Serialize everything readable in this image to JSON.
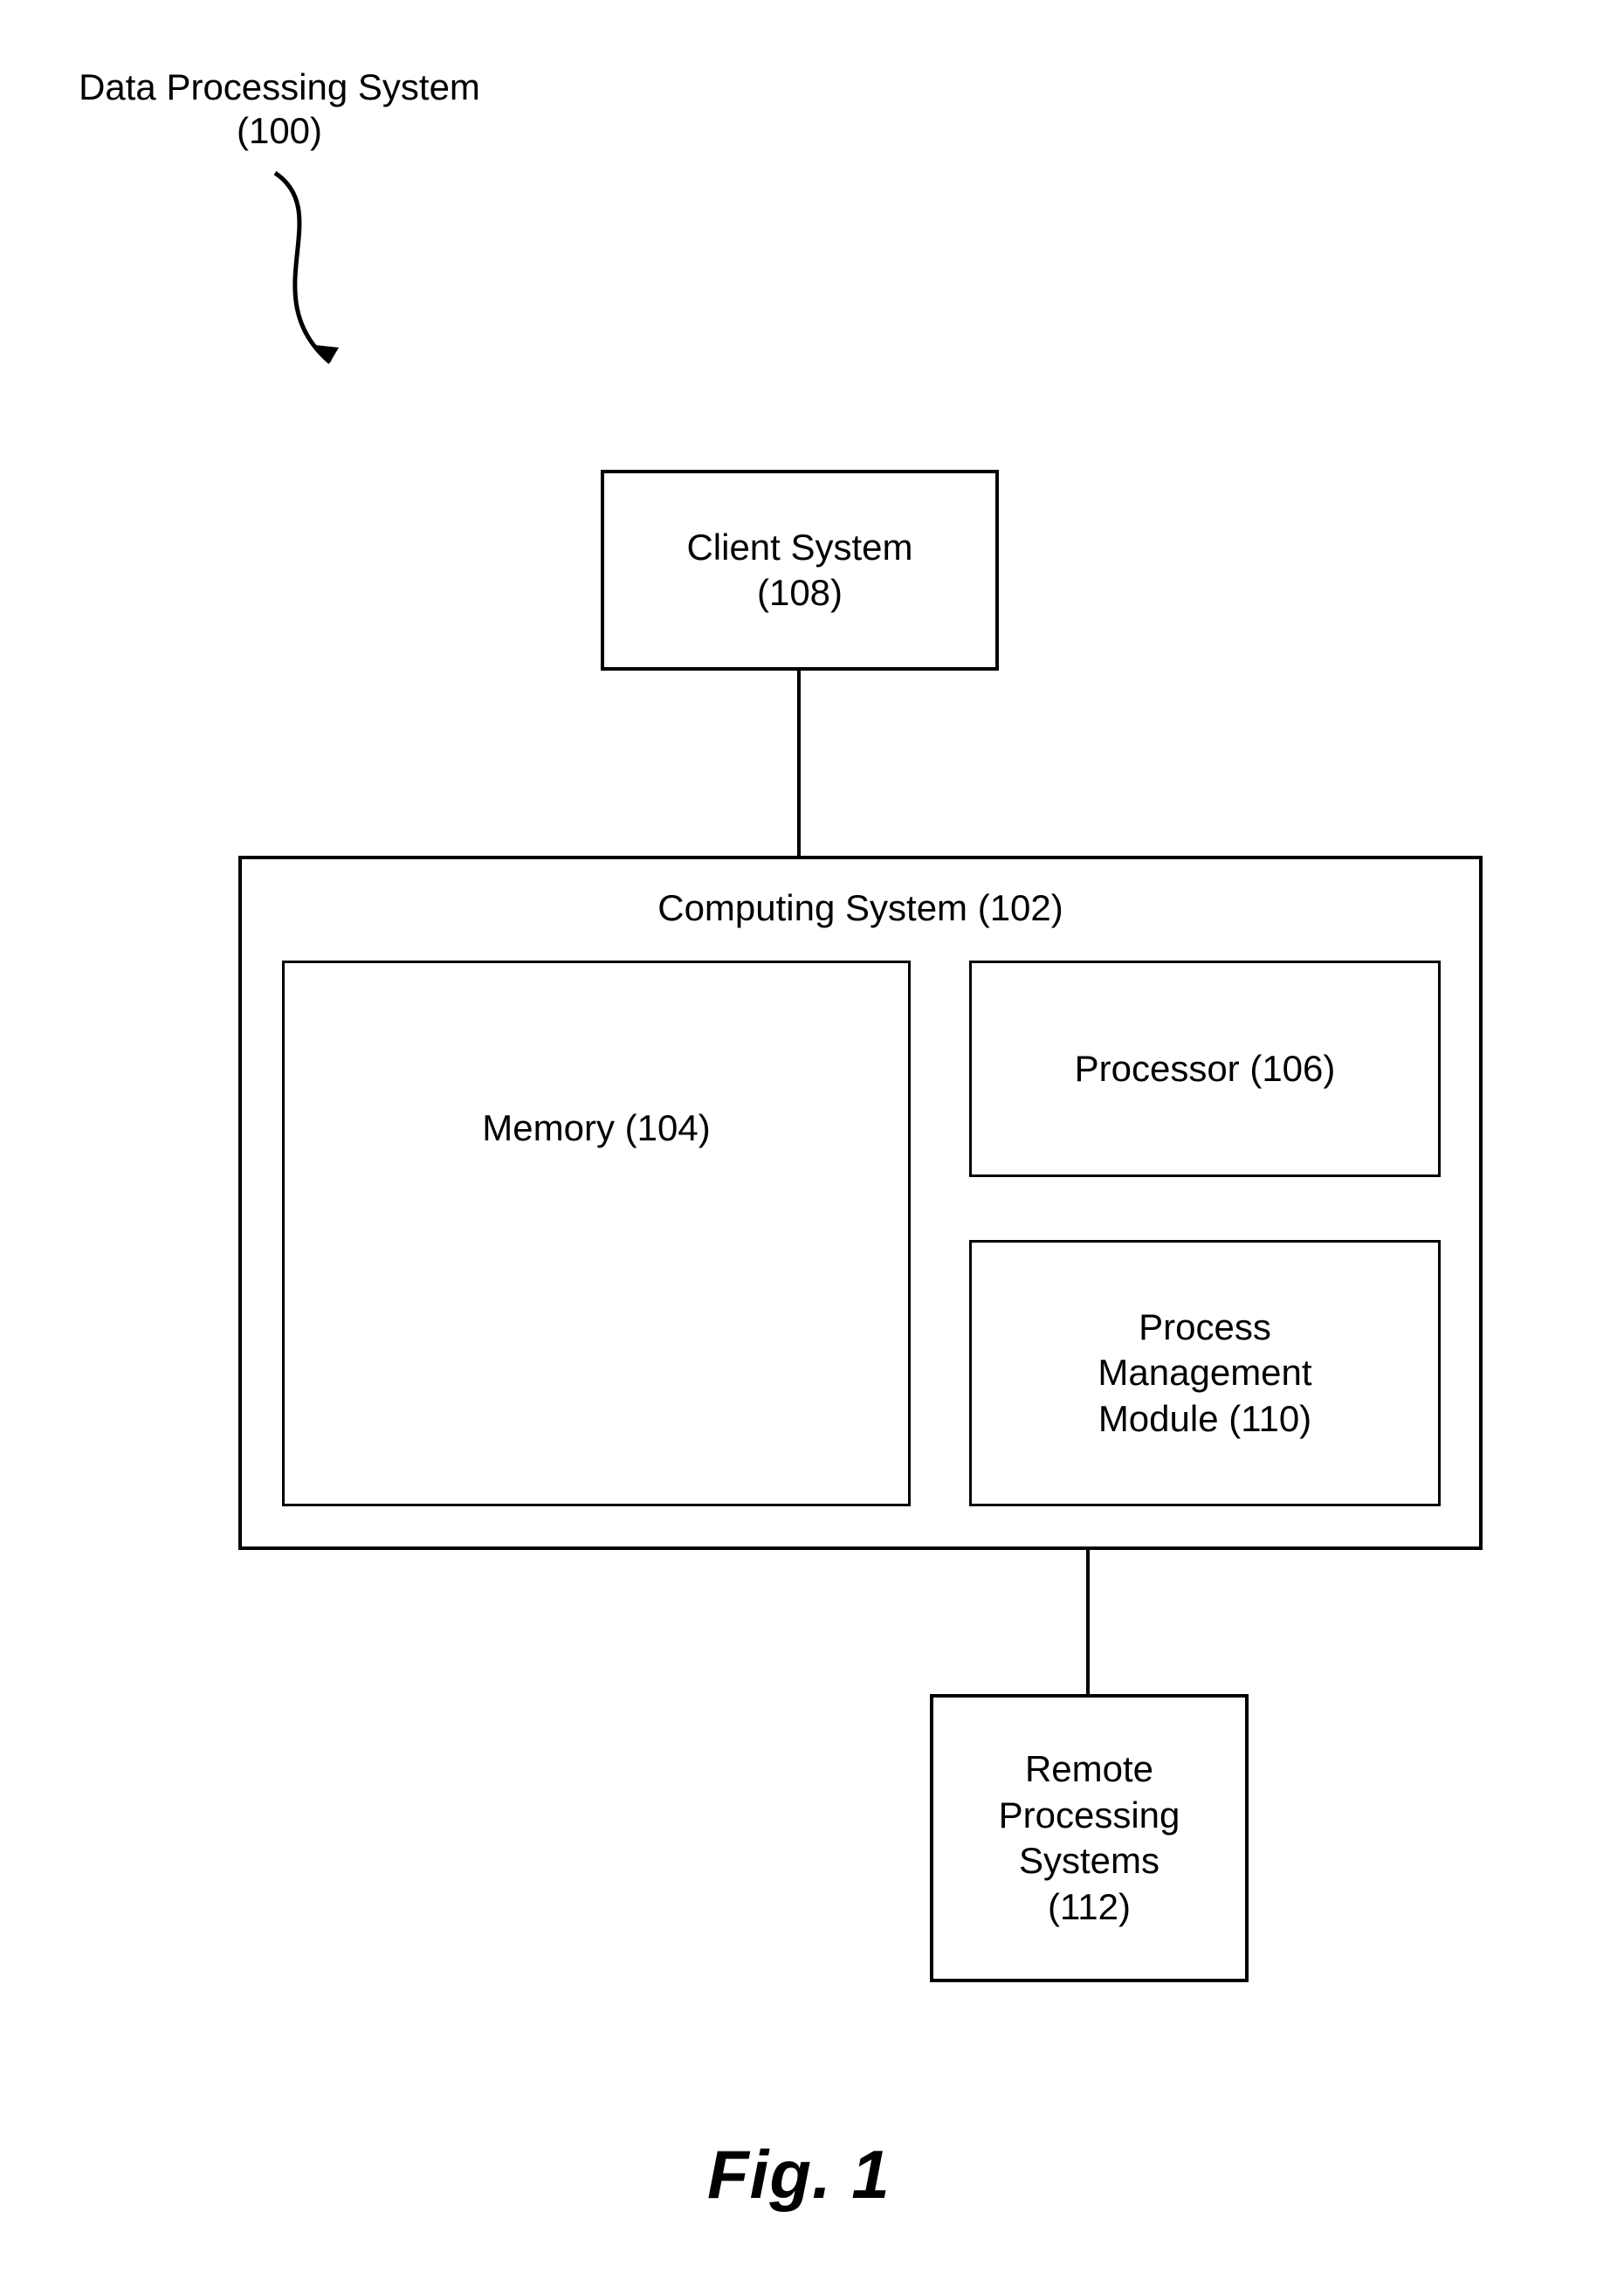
{
  "title": {
    "line1": "Data Processing System",
    "line2": "(100)"
  },
  "client": {
    "line1": "Client System",
    "line2": "(108)"
  },
  "computing": {
    "title": "Computing System (102)"
  },
  "memory": {
    "line1": "Memory (104)"
  },
  "processor": {
    "line1": "Processor (106)"
  },
  "pmm": {
    "line1": "Process",
    "line2": "Management",
    "line3": "Module (110)"
  },
  "remote": {
    "line1": "Remote",
    "line2": "Processing",
    "line3": "Systems",
    "line4": "(112)"
  },
  "figure": "Fig. 1"
}
